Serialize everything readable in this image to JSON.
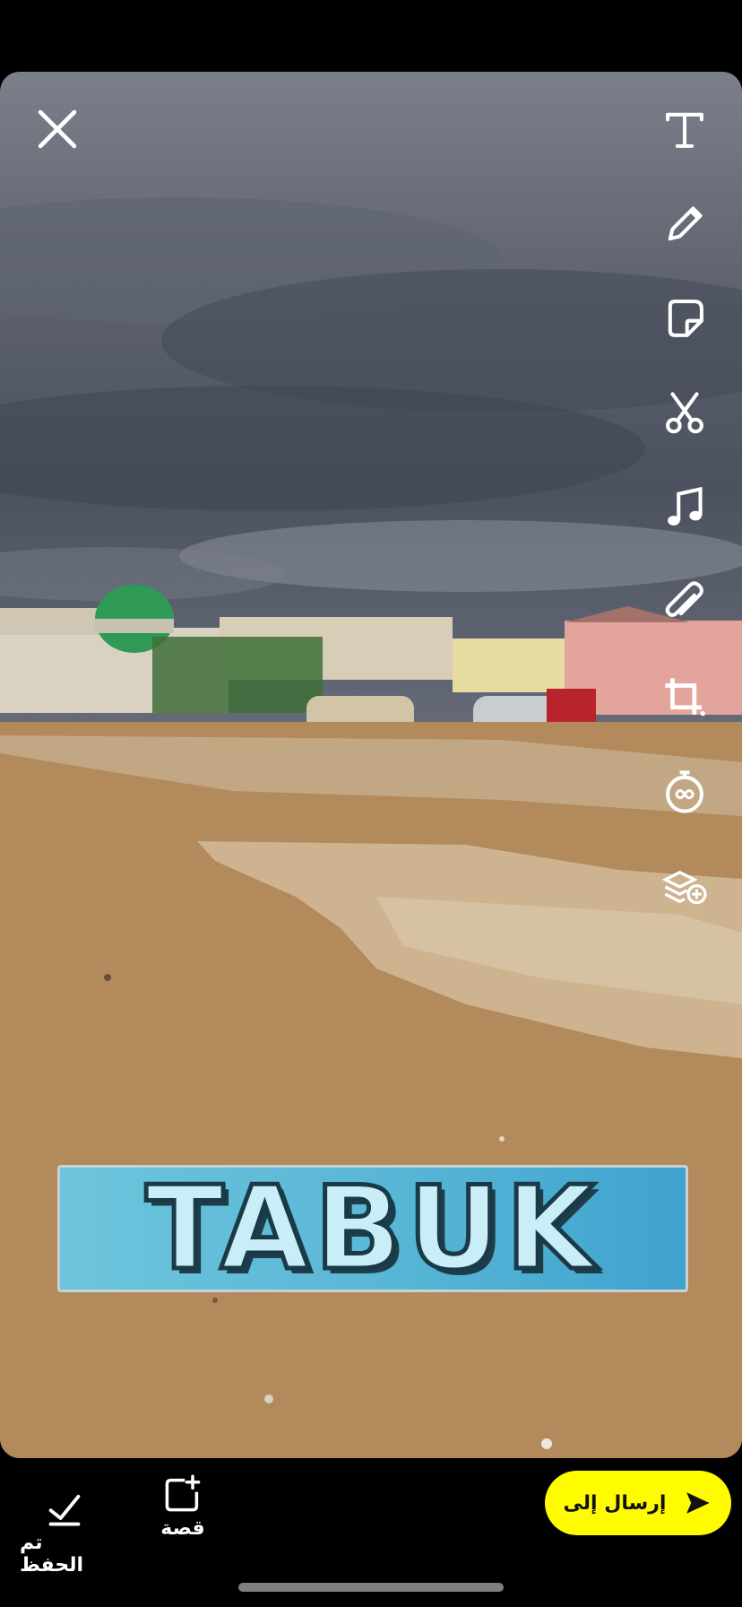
{
  "toolbar": {
    "close": "close-icon",
    "items": [
      "text-icon",
      "pencil-icon",
      "sticker-icon",
      "scissors-icon",
      "music-icon",
      "paperclip-icon",
      "crop-icon",
      "timer-icon",
      "layers-add-icon"
    ]
  },
  "sticker": {
    "text": "TABUK"
  },
  "actions": {
    "saved_label": "تم الحفظ",
    "story_label": "قصة"
  },
  "send": {
    "label": "إرسال إلى"
  },
  "colors": {
    "send_bg": "#fffc00",
    "sticker_blue": "#3fa3cf"
  }
}
